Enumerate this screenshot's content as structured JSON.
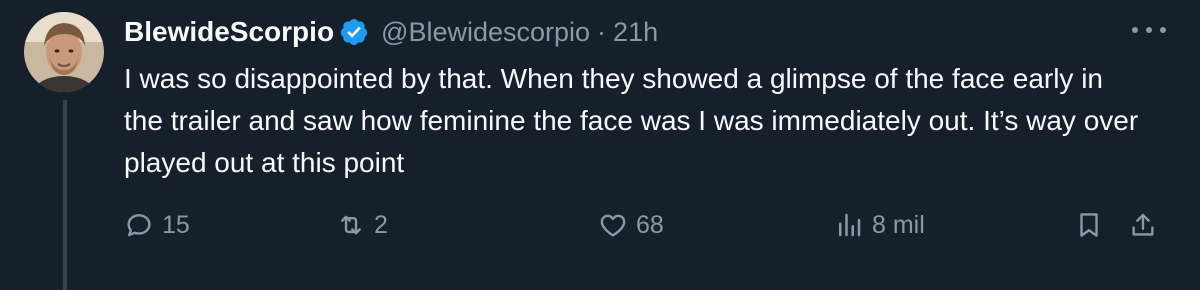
{
  "tweet": {
    "display_name": "BlewideScorpio",
    "handle": "@Blewidescorpio",
    "separator": "·",
    "time": "21h",
    "text": "I was so disappointed by that. When they showed a glimpse of the face early in the trailer and saw how feminine the face was I was immediately out. It’s way over played out at this point",
    "verified_color": "#1d9bf0"
  },
  "actions": {
    "replies": "15",
    "retweets": "2",
    "likes": "68",
    "views": "8 mil"
  },
  "icons": {
    "reply": "reply-icon",
    "retweet": "retweet-icon",
    "like": "heart-icon",
    "views": "bar-chart-icon",
    "bookmark": "bookmark-icon",
    "share": "share-icon",
    "more": "more-icon",
    "verified": "verified-badge-icon"
  }
}
